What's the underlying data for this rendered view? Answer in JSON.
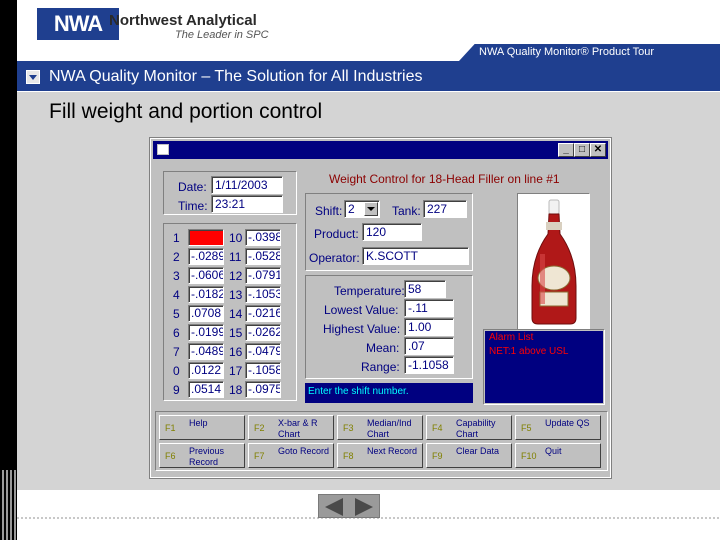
{
  "header": {
    "logo_abbr": "NWA",
    "company": "Northwest Analytical",
    "tagline": "The Leader in SPC",
    "tour_label": "NWA Quality Monitor® Product Tour"
  },
  "titlebar": {
    "title": "NWA Quality Monitor – The Solution for All Industries"
  },
  "main": {
    "heading": "Fill weight and portion control"
  },
  "app": {
    "window_title": "Weight Control for 18-Head Filler on line #1",
    "date_label": "Date:",
    "date_value": "1/11/2003",
    "time_label": "Time:",
    "time_value": "23:21",
    "shift_label": "Shift:",
    "shift_value": "2",
    "tank_label": "Tank:",
    "tank_value": "227",
    "product_label": "Product:",
    "product_value": "120",
    "operator_label": "Operator:",
    "operator_value": "K.SCOTT",
    "heads_left": [
      {
        "num": "1",
        "val": "",
        "alarm": true
      },
      {
        "num": "2",
        "val": "-.0289"
      },
      {
        "num": "3",
        "val": "-.0606"
      },
      {
        "num": "4",
        "val": "-.0182"
      },
      {
        "num": "5",
        "val": ".0708"
      },
      {
        "num": "6",
        "val": "-.0199"
      },
      {
        "num": "7",
        "val": "-.0489"
      },
      {
        "num": "0",
        "val": ".0122"
      },
      {
        "num": "9",
        "val": ".0514"
      }
    ],
    "heads_right": [
      {
        "num": "10",
        "val": "-.0398"
      },
      {
        "num": "11",
        "val": "-.0528"
      },
      {
        "num": "12",
        "val": "-.0791"
      },
      {
        "num": "13",
        "val": "-.1053"
      },
      {
        "num": "14",
        "val": "-.0216"
      },
      {
        "num": "15",
        "val": "-.0262"
      },
      {
        "num": "16",
        "val": "-.0479"
      },
      {
        "num": "17",
        "val": "-.1058"
      },
      {
        "num": "18",
        "val": "-.0975"
      }
    ],
    "stats": {
      "temperature_label": "Temperature:",
      "temperature_value": "58",
      "lowest_label": "Lowest Value:",
      "lowest_value": "-.11",
      "highest_label": "Highest Value:",
      "highest_value": "1.00",
      "mean_label": "Mean:",
      "mean_value": ".07",
      "range_label": "Range:",
      "range_value": "-1.1058"
    },
    "alarm_list_title": "Alarm List",
    "alarm_message": "NET:1 above USL",
    "status_text": "Enter the shift number.",
    "fkeys": [
      {
        "key": "F1",
        "label": "Help"
      },
      {
        "key": "F2",
        "label": "X-bar & R Chart"
      },
      {
        "key": "F3",
        "label": "Median/Ind Chart"
      },
      {
        "key": "F4",
        "label": "Capability Chart"
      },
      {
        "key": "F5",
        "label": "Update QS"
      },
      {
        "key": "F6",
        "label": "Previous Record"
      },
      {
        "key": "F7",
        "label": "Goto Record"
      },
      {
        "key": "F8",
        "label": "Next Record"
      },
      {
        "key": "F9",
        "label": "Clear Data"
      },
      {
        "key": "F10",
        "label": "Quit"
      }
    ]
  },
  "colors": {
    "brand_blue": "#1f3f8f",
    "window_navy": "#000080",
    "alarm_red": "#ff0000"
  },
  "icons": [
    "dropdown-arrow-icon",
    "minimize-icon",
    "maximize-icon",
    "close-icon",
    "nav-back-icon",
    "nav-forward-icon"
  ]
}
